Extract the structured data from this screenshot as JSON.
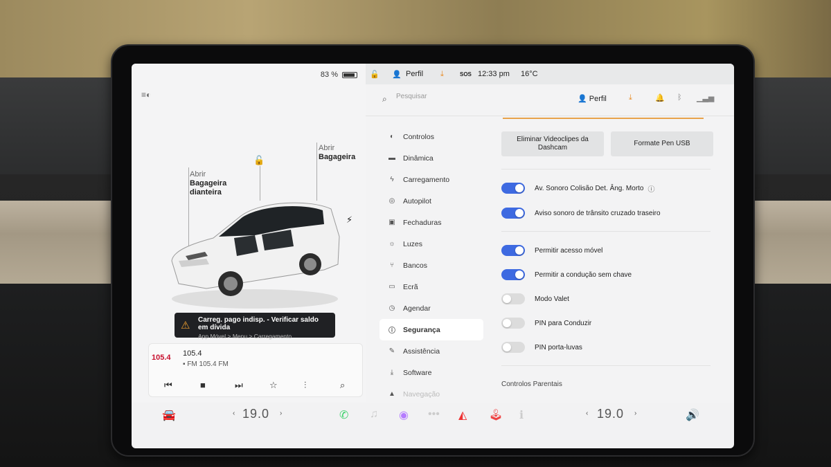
{
  "status": {
    "battery": "83 %",
    "profile": "Perfil",
    "time": "12:33 pm",
    "temp": "16°C",
    "sos": "SOS"
  },
  "car": {
    "front_trunk": {
      "line1": "Abrir",
      "line2": "Bagageira",
      "line3": "dianteira"
    },
    "rear_trunk": {
      "line1": "Abrir",
      "line2": "Bagageira"
    }
  },
  "alert": {
    "title": "Carreg. pago indisp. - Verificar saldo em dívida",
    "subtitle": "App Móvel > Menu > Carregamento"
  },
  "media": {
    "logo": "105.4",
    "station": "105.4",
    "sub": "FM 105.4 FM"
  },
  "search": {
    "placeholder": "Pesquisar"
  },
  "header": {
    "profile": "Perfil"
  },
  "nav": [
    {
      "label": "Controlos",
      "icon": "toggle-icon"
    },
    {
      "label": "Dinâmica",
      "icon": "car-icon"
    },
    {
      "label": "Carregamento",
      "icon": "bolt-icon"
    },
    {
      "label": "Autopilot",
      "icon": "steering-icon"
    },
    {
      "label": "Fechaduras",
      "icon": "lock-icon"
    },
    {
      "label": "Luzes",
      "icon": "sun-icon"
    },
    {
      "label": "Bancos",
      "icon": "seat-icon"
    },
    {
      "label": "Ecrã",
      "icon": "display-icon"
    },
    {
      "label": "Agendar",
      "icon": "clock-icon"
    },
    {
      "label": "Segurança",
      "icon": "shield-icon"
    },
    {
      "label": "Assistência",
      "icon": "wrench-icon"
    },
    {
      "label": "Software",
      "icon": "download-icon"
    },
    {
      "label": "Navegação",
      "icon": "navigation-icon"
    }
  ],
  "buttons": {
    "delete_clips": "Eliminar Videoclipes da Dashcam",
    "format_usb": "Formate Pen USB"
  },
  "toggles": [
    {
      "label": "Av. Sonoro Colisão Det. Âng. Morto",
      "on": true
    },
    {
      "label": "Aviso sonoro de trânsito cruzado traseiro",
      "on": true
    },
    {
      "label": "Permitir acesso móvel",
      "on": true
    },
    {
      "label": "Permitir a condução sem chave",
      "on": true
    },
    {
      "label": "Modo Valet",
      "on": false
    },
    {
      "label": "PIN para Conduzir",
      "on": false
    },
    {
      "label": "PIN porta-luvas",
      "on": false
    }
  ],
  "section": {
    "parental": "Controlos Parentais"
  },
  "climate": {
    "left": "19.0",
    "right": "19.0"
  }
}
